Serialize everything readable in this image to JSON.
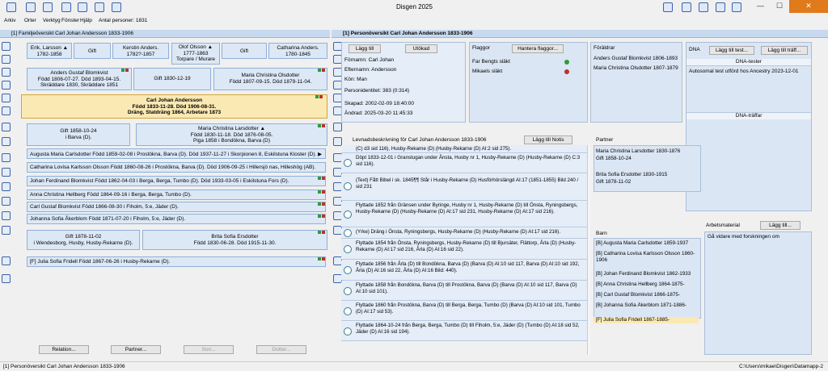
{
  "app": {
    "title": "Disgen 2025"
  },
  "menu": {
    "arkiv": "Arkiv",
    "orter": "Orter",
    "verktyg": "Verktyg",
    "fonster": "Fönster",
    "hjalp": "Hjälp",
    "antal": "Antal personer: 1831"
  },
  "left": {
    "title": "[1] Familjeöversikt Carl Johan Andersson 1833-1906",
    "ggp": [
      {
        "l1": "Erik, Larsson ▲",
        "l2": "1782-1858"
      },
      {
        "l1": "Gift",
        "l2": ""
      },
      {
        "l1": "Kerstin Anders.",
        "l2": "1782?-1857"
      },
      {
        "l1": "Olof Olsson ▲",
        "l2": "1777-1863",
        "l3": "Torpare / Murare"
      },
      {
        "l1": "Gift",
        "l2": ""
      },
      {
        "l1": "Catharina Anders.",
        "l2": "1780-1845"
      }
    ],
    "gp": [
      {
        "l1": "Anders Gustaf Blomkvist",
        "l2": "Född 1806-07-27. Död 1893-04-15.",
        "l3": "Skräddare 1830, Skräddare 1851"
      },
      {
        "l1": "Gift 1830-12-19"
      },
      {
        "l1": "Maria Christina Olsdotter",
        "l2": "Född 1807-09-15. Död 1879-11-04."
      }
    ],
    "main": {
      "l1": "Carl Johan Andersson",
      "l2": "Född 1833-11-28. Död 1906-08-31.",
      "l3": "Dräng, Statdräng 1864, Arbetare 1873"
    },
    "marr1": {
      "l1": "Gift 1858-10-24",
      "l2": "i Barva (D)."
    },
    "spouse1": {
      "l1": "Maria Christina Larsdotter ▲",
      "l2": "Född 1830-11-18. Död 1876-08-05.",
      "l3": "Piga 1858 i Bondökna, Barva (D)"
    },
    "children1": [
      "Augusta Maria Carlsdotter Född 1859-02-08 i Prostökna, Barva (D). Död 1937-11-27 i Skorpionen 8, Eskilstuna Kloster (D). ▶",
      "Catharina Lovisa Karlsson Olsson Född 1860-08-26 i Prostökna, Barva (D). Död 1906-09-25 i Hillersjö nas, Hilleshög (AB).",
      "Johan Ferdinand Blomkvist Född 1862-04-03 i Berga, Berga, Tumbo (D). Död 1933-03-05 i Eskilstuna Fors (D).",
      "Anna Christina Hellberg Född 1864-09-16 i Berga, Berga, Tumbo (D).",
      "Carl Gustaf Blomkvist Född 1866-08-30 i Fiholm, 5:e, Jäder (D).",
      "Johanna Sofia Åkerblom Född 1871-07-20 i Fiholm, 5:e, Jäder (D)."
    ],
    "marr2": {
      "l1": "Gift 1878-11-02",
      "l2": "i Wendesborg, Husby, Husby-Rekarne (D)."
    },
    "spouse2": {
      "l1": "Brita Sofia Ersdotter",
      "l2": "Född 1830-06-28. Död 1915-11-30."
    },
    "children2": [
      "[F] Julia Sofia Fridell Född 1867-06-26 i Husby-Rekarne (D)."
    ],
    "buttons": {
      "relation": "Relation...",
      "partner": "Partner...",
      "son": "Son...",
      "dotter": "Dotter..."
    }
  },
  "right": {
    "title": "[1] Personöversikt Carl Johan Andersson 1833-1906",
    "namn": {
      "btn1": "Lägg till",
      "btn2": "Utökad",
      "fornamn": "Förnamn: Carl Johan",
      "efternamn": "Efternamn: Andersson",
      "kon": "Kön: Man",
      "pid": "Personidentitet: 383 (0:314)",
      "skapad": "Skapad:  2002-02-09 18:40:00",
      "andrad": "Ändrad:  2025-03-20 11:45:33"
    },
    "flaggor": {
      "title": "Flaggor",
      "btn": "Hantera flaggor...",
      "items": [
        "Far Bengts släkt",
        "Mikaels släkt"
      ]
    },
    "foraldrar": {
      "title": "Föräldrar",
      "items": [
        "Anders Gustaf Blomkvist 1806-1893",
        "Maria Christina Olsdotter 1807-1879"
      ]
    },
    "dna": {
      "title": "DNA",
      "btn1": "Lägg till test...",
      "btn2": "Lägg till träff...",
      "tester": "DNA-tester",
      "test1": "Autosomal test utförd hos Ancestry 2023-12-01",
      "traffar": "DNA-träffar"
    },
    "lev": {
      "title": "Levnadsbeskrivning för Carl Johan Andersson 1833-1906",
      "btn": "Lägg till Notis",
      "events": [
        "(C) d3 sid 116), Husby-Rekarne (D) (Husby-Rekarne (D) AI:2 sid 275).",
        "Döpt 1833-12-01 i Granstugan under Ånsta, Husby nr 1, Husby-Rekarne (D) (Husby-Rekarne (D) C:3 sid 116).",
        "(Text) Fått Bibel i sk. 1845¶¶ Står i Husby-Rekarne (D) Husförhörslängd AI:17 (1851-1855) Bild 240 / sid 231",
        "Flyttade 1852 från Gränsen under Byringe, Husby nr 1, Husby-Rekarne (D) till Önsta, Ryningsbergs, Husby-Rekarne (D) (Husby-Rekarne (D) AI:17 sid 231, Husby-Rekarne (D) AI:17 sid 216).",
        "(Yrke) Dräng i Önsta, Ryningsbergs, Husby-Rekarne (D) (Husby-Rekarne (D) AI:17 sid 216).",
        "Flyttade 1854 från Önsta, Ryningsbergs, Husby-Rekarne (D) till Bjursäter, Flättorp, Årla (D) (Husby-Rekarne (D) AI:17 sid 216, Årla (D) AI:16 sid 22).",
        "Flyttade 1856 från Årla (D) till Bondökna, Barva (D) (Barva (D) AI:10 sid 117, Barva (D) AI:10 sid 192, Årla (D) AI:16 sid 22, Årla (D) AI:16 Bild: 440).",
        "Flyttade 1858 från Bondökna, Barva (D) till Prostökna, Barva (D) (Barva (D) AI:10 sid 117, Barva (D) AI:10 sid 101).",
        "Flyttade 1860 från Prostökna, Barva (D) till Berga, Berga, Tumbo (D) (Barva (D) AI:10 sid 101, Tumbo (D) AI:17 sid 53).",
        "Flyttade 1864-10-24 från Berga, Berga, Tumbo (D) till Fiholm, 5:e, Jäder (D) (Tumbo (D) AI:18 sid 52, Jäder (D) AI:16 sid 194)."
      ]
    },
    "partner": {
      "title": "Partner",
      "items": [
        [
          "Maria Christina  Larsdotter  1830-1876",
          "Gift 1858-10-24"
        ],
        [
          "Brita Sofia Ersdotter  1830-1915",
          "Gift 1878-11-02"
        ]
      ]
    },
    "arbets": {
      "title": "Arbetsmaterial",
      "btn": "Lägg till...",
      "text": "Gå vidare med forskningen om"
    },
    "barn": {
      "title": "Barn",
      "items": [
        "[B] Augusta Maria Carlsdotter  1859-1937",
        "[B] Catharina Lovisa Karlsson  Olsson  1860-1906",
        "[B] Johan Ferdinand Blomkvist  1862-1933",
        "[B] Anna Christina  Hellberg  1864-1875-",
        "[B] Carl Gustaf Blomkvist  1866-1875-",
        "[B] Johanna Sofia Åkerblom  1871-1886-",
        "[F] Julia Sofia Fridell  1867-1885-"
      ]
    }
  },
  "status": {
    "left": "[1] Personöversikt Carl Johan Andersson 1833-1906",
    "right": "C:\\Users\\mikae\\Disgen\\Datamapp-2"
  },
  "colors": {
    "titlebar": "#c7d9ee",
    "box": "#dce8f6",
    "selected": "#fbe9b3",
    "close": "#e07a1a"
  }
}
